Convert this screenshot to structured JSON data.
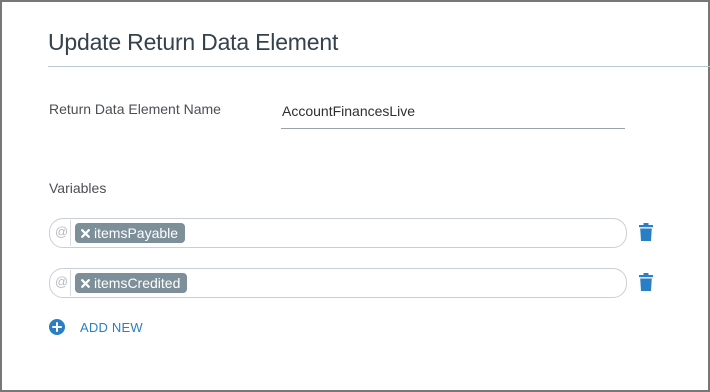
{
  "dialog": {
    "title": "Update Return Data Element"
  },
  "name_field": {
    "label": "Return Data Element Name",
    "value": "AccountFinancesLive"
  },
  "variables": {
    "label": "Variables",
    "at_symbol": "@",
    "items": [
      {
        "chip": "itemsPayable"
      },
      {
        "chip": "itemsCredited"
      }
    ],
    "add_new_label": "ADD NEW"
  },
  "colors": {
    "accent": "#2a7fc4",
    "chip_bg": "#7d8f99",
    "title_text": "#35414d"
  },
  "icons": {
    "chip_remove": "close-icon",
    "delete": "trash-icon",
    "add": "plus-circle-icon"
  }
}
